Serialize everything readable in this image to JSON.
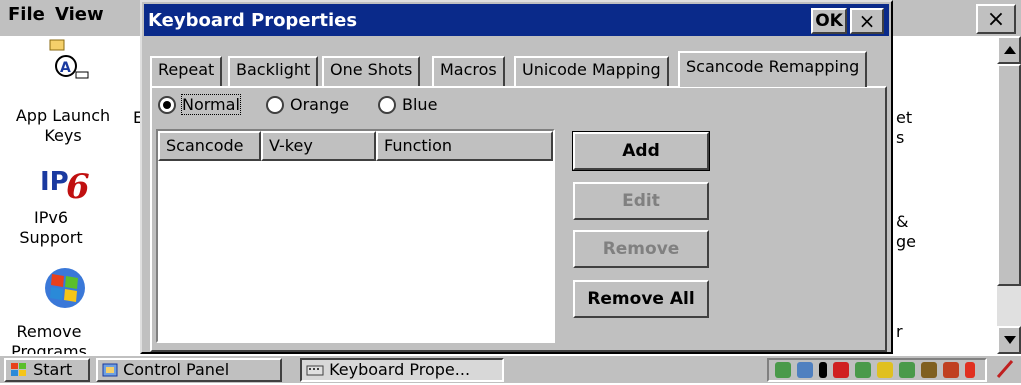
{
  "control_panel": {
    "menu": [
      "File",
      "View"
    ],
    "close_glyph": "×",
    "icons": [
      {
        "label_line1": "App Launch",
        "label_line2": "Keys",
        "icon": "app-launch-keys-icon"
      },
      {
        "label_line1": "IPv6",
        "label_line2": "Support",
        "icon": "ipv6-icon"
      },
      {
        "label_line1": "Remove",
        "label_line2": "Programs",
        "icon": "windows-flag-icon"
      }
    ],
    "partial_right_text": [
      "et",
      "s",
      "&",
      "ge",
      "r"
    ],
    "partial_left_text": [
      "E"
    ]
  },
  "dialog": {
    "title": "Keyboard Properties",
    "ok_label": "OK",
    "close_glyph": "×",
    "tabs": [
      {
        "label": "Repeat",
        "active": false
      },
      {
        "label": "Backlight",
        "active": false
      },
      {
        "label": "One Shots",
        "active": false
      },
      {
        "label": "Macros",
        "active": false
      },
      {
        "label": "Unicode Mapping",
        "active": false
      },
      {
        "label": "Scancode Remapping",
        "active": true
      }
    ],
    "radios": [
      {
        "label": "Normal",
        "selected": true
      },
      {
        "label": "Orange",
        "selected": false
      },
      {
        "label": "Blue",
        "selected": false
      }
    ],
    "columns": [
      "Scancode",
      "V-key",
      "Function"
    ],
    "buttons": {
      "add": "Add",
      "edit": "Edit",
      "remove": "Remove",
      "remove_all": "Remove All"
    }
  },
  "taskbar": {
    "start": "Start",
    "tasks": [
      "Control Panel",
      "Keyboard Prope..."
    ]
  },
  "colors": {
    "titlebar": "#0a2a8a",
    "face": "#c0c0c0"
  }
}
